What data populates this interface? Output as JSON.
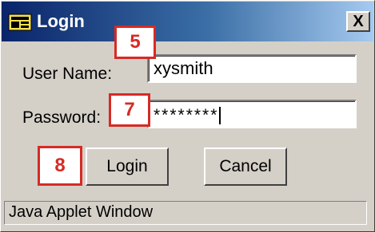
{
  "window": {
    "title": "Login",
    "icon": "applet-window-icon",
    "close_label": "X"
  },
  "form": {
    "username_label": "User Name:",
    "username_value": "xysmith",
    "password_label": "Password:",
    "password_value": "********"
  },
  "buttons": {
    "login_label": "Login",
    "cancel_label": "Cancel"
  },
  "status": {
    "text": "Java Applet Window"
  },
  "callouts": {
    "username": "5",
    "password": "7",
    "login": "8"
  },
  "colors": {
    "titlebar_start": "#0a246a",
    "titlebar_end": "#a6caf0",
    "callout": "#d72a24",
    "face": "#d4d0c8"
  }
}
